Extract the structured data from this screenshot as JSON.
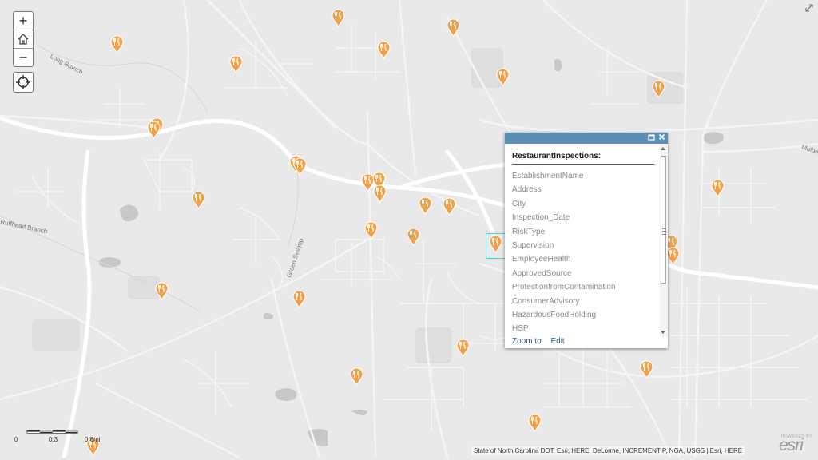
{
  "zoom_controls": {
    "zoom_in": "+",
    "zoom_out": "−"
  },
  "popup": {
    "title": "RestaurantInspections:",
    "fields": [
      "EstablishmentName",
      "Address",
      "City",
      "Inspection_Date",
      "RiskType",
      "Supervision",
      "EmployeeHealth",
      "ApprovedSource",
      "ProtectionfromContamination",
      "ConsumerAdvisory",
      "HazardousFoodHolding",
      "HSP"
    ],
    "zoom_to_label": "Zoom to",
    "edit_label": "Edit",
    "header_color": "#5a8fb4"
  },
  "map": {
    "road_labels": [
      "Long Branch",
      "Mulbe",
      "Green Swamp",
      "Ruffhead Branch"
    ],
    "marker_color": "#f0a24a",
    "marker_icon": "restaurant-fork-knife-icon",
    "selection_color": "#35d5e0"
  },
  "scalebar": {
    "labels": [
      "0",
      "0.3",
      "0.6mi"
    ]
  },
  "attribution": "State of North Carolina DOT, Esri, HERE, DeLorme, INCREMENT P, NGA, USGS | Esri, HERE",
  "logo": {
    "powered_by": "POWERED BY",
    "name": "esri"
  }
}
